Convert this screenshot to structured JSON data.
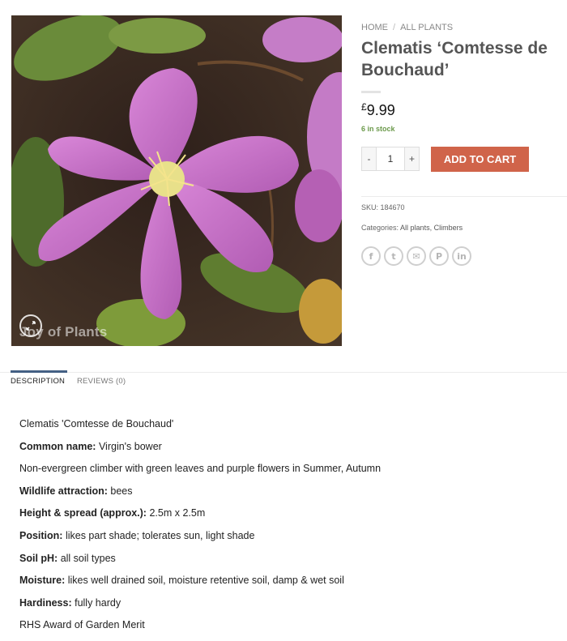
{
  "breadcrumb": {
    "home": "HOME",
    "separator": "/",
    "all_plants": "ALL PLANTS"
  },
  "product": {
    "title_line1": "Clematis ‘Comtesse de",
    "title_line2": "Bouchaud’",
    "currency": "£",
    "price": "9.99",
    "stock": "6 in stock",
    "quantity": "1",
    "qty_minus": "-",
    "qty_plus": "+",
    "add_to_cart": "ADD TO CART",
    "sku_label": "SKU:",
    "sku": "184670",
    "categories_label": "Categories:",
    "category_1": "All plants",
    "category_sep": ",",
    "category_2": "Climbers",
    "image_watermark": "Joy of Plants",
    "share_icons": [
      "facebook-icon",
      "twitter-icon",
      "email-icon",
      "pinterest-icon",
      "linkedin-icon"
    ],
    "share_glyphs": {
      "facebook": "f",
      "twitter": "t",
      "email": "✉",
      "pinterest": "P",
      "linkedin": "in"
    }
  },
  "tabs": {
    "description": "DESCRIPTION",
    "reviews": "REVIEWS (0)"
  },
  "description": {
    "name": "Clematis 'Comtesse de Bouchaud'",
    "common_name_label": "Common name:",
    "common_name": "Virgin's bower",
    "summary": "Non-evergreen climber with green leaves and purple flowers in Summer, Autumn",
    "wildlife_label": "Wildlife attraction:",
    "wildlife": "bees",
    "size_label": "Height & spread (approx.):",
    "size": "2.5m x 2.5m",
    "position_label": "Position:",
    "position": "likes part shade; tolerates sun, light shade",
    "soil_label": "Soil pH:",
    "soil": "all soil types",
    "moisture_label": "Moisture:",
    "moisture": "likes well drained soil, moisture retentive soil, damp & wet soil",
    "hardiness_label": "Hardiness:",
    "hardiness": "fully hardy",
    "award": "RHS Award of Garden Merit"
  },
  "colors": {
    "button": "#d0644a",
    "stock_green": "#6c9a4c",
    "tab_active": "#446084",
    "flower_pink": "#c86ec8",
    "background_dark": "#3a2a26"
  }
}
